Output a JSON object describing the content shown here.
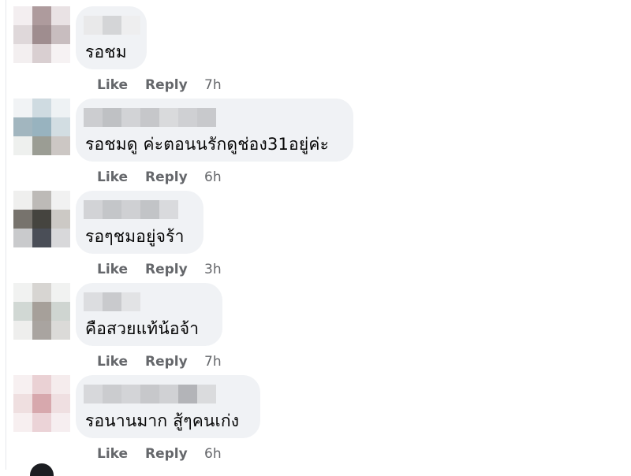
{
  "comments": [
    {
      "text": "รอชม",
      "like_label": "Like",
      "reply_label": "Reply",
      "time": "7h",
      "avatar_colors": [
        "#f3eef0",
        "#ae9b9d",
        "#e9e2e4",
        "#dfd8da",
        "#9f8d8f",
        "#c8bdbf",
        "#f3eff0",
        "#d9cfd1",
        "#f6f2f3"
      ],
      "name_blur_colors": [
        "#e9e9ea",
        "#d4d5d7",
        "#eeeeef"
      ]
    },
    {
      "text": "รอชมดู ค่ะตอนนรักดูช่อง31อยู่ค่ะ",
      "like_label": "Like",
      "reply_label": "Reply",
      "time": "6h",
      "avatar_colors": [
        "#f1f3f5",
        "#cfdbe1",
        "#eef2f4",
        "#a2b6bf",
        "#98b3bf",
        "#d2dde2",
        "#eef0ee",
        "#9b9d94",
        "#ccc7c4"
      ],
      "name_blur_colors": [
        "#cccdd0",
        "#bfc1c4",
        "#d2d3d6",
        "#c6c7ca",
        "#d9dadc",
        "#cfd0d3",
        "#c8c9cc"
      ]
    },
    {
      "text": "รอๆชมอยู่จร้า",
      "like_label": "Like",
      "reply_label": "Reply",
      "time": "3h",
      "avatar_colors": [
        "#efefee",
        "#bdbab7",
        "#f1f1f1",
        "#77736d",
        "#45443f",
        "#ccc9c5",
        "#c9cacc",
        "#4a4e57",
        "#d8d8da"
      ],
      "name_blur_colors": [
        "#d2d3d6",
        "#c4c6c9",
        "#cfd0d3",
        "#c2c4c7",
        "#d9dadd"
      ]
    },
    {
      "text": "คือสวยแท้น้อจ้า",
      "like_label": "Like",
      "reply_label": "Reply",
      "time": "7h",
      "avatar_colors": [
        "#f1f2f1",
        "#d7d5d2",
        "#f1f2f1",
        "#d1d8d4",
        "#a6a09a",
        "#cfd5d1",
        "#eeeeed",
        "#a9a4a0",
        "#dbdad8"
      ],
      "name_blur_colors": [
        "#dcdde0",
        "#c9cacd",
        "#e2e3e5"
      ]
    },
    {
      "text": "รอนานมาก สู้ๆคนเก่ง",
      "like_label": "Like",
      "reply_label": "Reply",
      "time": "6h",
      "avatar_colors": [
        "#f7f0f1",
        "#ead1d4",
        "#f5eced",
        "#efdfe0",
        "#d7a8ad",
        "#efdfe1",
        "#f7eff0",
        "#ebd3d7",
        "#f6eef0"
      ],
      "name_blur_colors": [
        "#d7d8db",
        "#cbcccf",
        "#d3d4d7",
        "#c7c8cb",
        "#d0d1d4",
        "#b3b4b8",
        "#dadbdd"
      ]
    }
  ]
}
